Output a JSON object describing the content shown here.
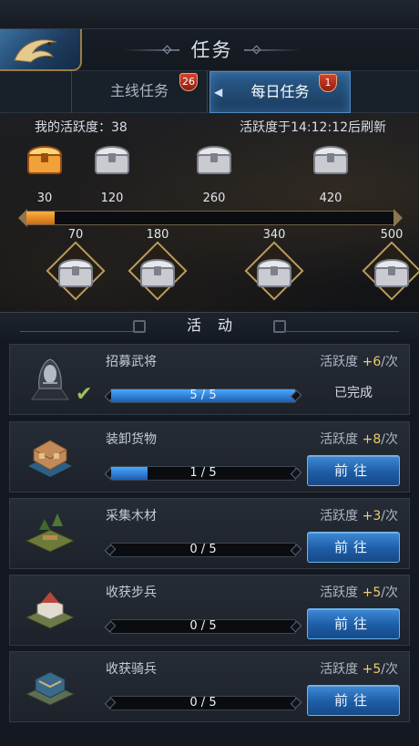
{
  "header": {
    "title": "任务"
  },
  "tabs": [
    {
      "label": "主线任务",
      "badge": "26",
      "active": false
    },
    {
      "label": "每日任务",
      "badge": "1",
      "active": true
    }
  ],
  "activity": {
    "my_activity_label": "我的活跃度：38",
    "refresh_label": "活跃度于14:12:12后刷新",
    "current": 38,
    "max": 500,
    "top_chests": [
      {
        "threshold": "30",
        "state": "open"
      },
      {
        "threshold": "120",
        "state": "locked"
      },
      {
        "threshold": "260",
        "state": "locked"
      },
      {
        "threshold": "420",
        "state": "locked"
      }
    ],
    "bottom_chests": [
      {
        "threshold": "70",
        "state": "locked"
      },
      {
        "threshold": "180",
        "state": "locked"
      },
      {
        "threshold": "340",
        "state": "locked"
      },
      {
        "threshold": "500",
        "state": "locked"
      }
    ]
  },
  "section": {
    "title": "活动"
  },
  "tasks": [
    {
      "name": "招募武将",
      "reward_prefix": "活跃度 ",
      "reward_points": "+6",
      "reward_suffix": "/次",
      "progress_text": "5 / 5",
      "progress": 1.0,
      "status": "已完成",
      "icon": "helmet-icon"
    },
    {
      "name": "装卸货物",
      "reward_prefix": "活跃度 ",
      "reward_points": "+8",
      "reward_suffix": "/次",
      "progress_text": "1 / 5",
      "progress": 0.2,
      "button": "前往",
      "icon": "warehouse-icon"
    },
    {
      "name": "采集木材",
      "reward_prefix": "活跃度 ",
      "reward_points": "+3",
      "reward_suffix": "/次",
      "progress_text": "0 / 5",
      "progress": 0,
      "button": "前往",
      "icon": "lumber-camp-icon"
    },
    {
      "name": "收获步兵",
      "reward_prefix": "活跃度 ",
      "reward_points": "+5",
      "reward_suffix": "/次",
      "progress_text": "0 / 5",
      "progress": 0,
      "button": "前往",
      "icon": "infantry-camp-icon"
    },
    {
      "name": "收获骑兵",
      "reward_prefix": "活跃度 ",
      "reward_points": "+5",
      "reward_suffix": "/次",
      "progress_text": "0 / 5",
      "progress": 0,
      "button": "前往",
      "icon": "cavalry-camp-icon"
    }
  ],
  "colors": {
    "accent_blue": "#2a6fbd",
    "gold": "#f0cc6a",
    "progress_orange": "#f39a2c"
  }
}
